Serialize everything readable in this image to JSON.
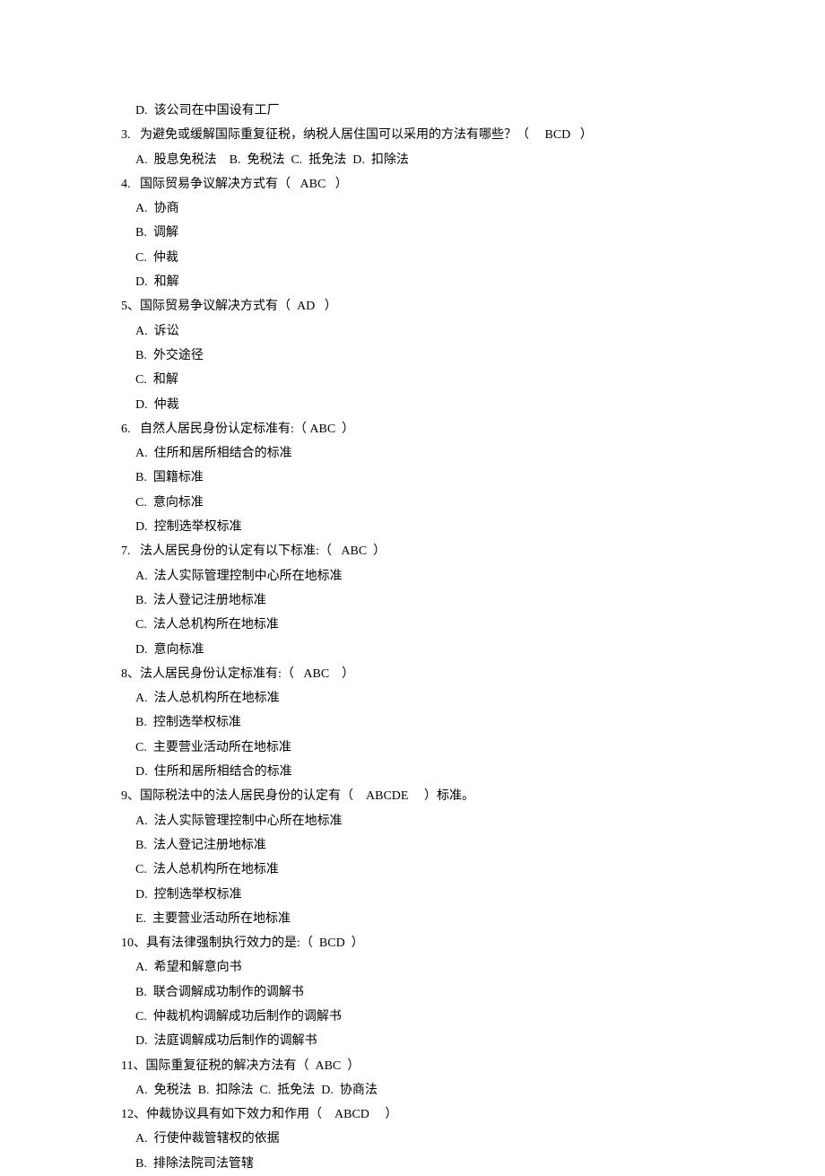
{
  "lines": [
    {
      "cls": "indent1",
      "text": "D.  该公司在中国设有工厂"
    },
    {
      "cls": "",
      "text": "3.   为避免或缓解国际重复征税，纳税人居住国可以采用的方法有哪些？（     BCD   ）"
    },
    {
      "cls": "indent1",
      "text": "A.  股息免税法    B.  免税法  C.  抵免法  D.  扣除法"
    },
    {
      "cls": "",
      "text": "4.   国际贸易争议解决方式有（   ABC   ）"
    },
    {
      "cls": "indent1",
      "text": "A.  协商"
    },
    {
      "cls": "indent1",
      "text": "B.  调解"
    },
    {
      "cls": "indent1",
      "text": "C.  仲裁"
    },
    {
      "cls": "indent1",
      "text": "D.  和解"
    },
    {
      "cls": "",
      "text": "5、国际贸易争议解决方式有（  AD   ）"
    },
    {
      "cls": "indent1",
      "text": "A.  诉讼"
    },
    {
      "cls": "indent1",
      "text": "B.  外交途径"
    },
    {
      "cls": "indent1",
      "text": "C.  和解"
    },
    {
      "cls": "indent1",
      "text": "D.  仲裁"
    },
    {
      "cls": "",
      "text": "6.   自然人居民身份认定标准有:（ ABC  ）"
    },
    {
      "cls": "indent1",
      "text": "A.  住所和居所相结合的标准"
    },
    {
      "cls": "indent1",
      "text": "B.  国籍标准"
    },
    {
      "cls": "indent1",
      "text": "C.  意向标准"
    },
    {
      "cls": "indent1",
      "text": "D.  控制选举权标准"
    },
    {
      "cls": "",
      "text": "7.   法人居民身份的认定有以下标准:（   ABC  ）"
    },
    {
      "cls": "indent1",
      "text": "A.  法人实际管理控制中心所在地标准"
    },
    {
      "cls": "indent1",
      "text": "B.  法人登记注册地标准"
    },
    {
      "cls": "indent1",
      "text": "C.  法人总机构所在地标准"
    },
    {
      "cls": "indent1",
      "text": "D.  意向标准"
    },
    {
      "cls": "",
      "text": "8、法人居民身份认定标准有:（   ABC    ）"
    },
    {
      "cls": "indent1",
      "text": "A.  法人总机构所在地标准"
    },
    {
      "cls": "indent1",
      "text": "B.  控制选举权标准"
    },
    {
      "cls": "indent1",
      "text": "C.  主要营业活动所在地标准"
    },
    {
      "cls": "indent1",
      "text": "D.  住所和居所相结合的标准"
    },
    {
      "cls": "",
      "text": "9、国际税法中的法人居民身份的认定有（    ABCDE     ）标准。"
    },
    {
      "cls": "indent1",
      "text": "A.  法人实际管理控制中心所在地标准"
    },
    {
      "cls": "indent1",
      "text": "B.  法人登记注册地标准"
    },
    {
      "cls": "indent1",
      "text": "C.  法人总机构所在地标准"
    },
    {
      "cls": "indent1",
      "text": "D.  控制选举权标准"
    },
    {
      "cls": "indent1",
      "text": "E.  主要营业活动所在地标准"
    },
    {
      "cls": "",
      "text": "10、具有法律强制执行效力的是:（  BCD  ）"
    },
    {
      "cls": "indent1",
      "text": "A.  希望和解意向书"
    },
    {
      "cls": "indent1",
      "text": "B.  联合调解成功制作的调解书"
    },
    {
      "cls": "indent1",
      "text": "C.  仲裁机构调解成功后制作的调解书"
    },
    {
      "cls": "indent1",
      "text": "D.  法庭调解成功后制作的调解书"
    },
    {
      "cls": "",
      "text": "11、国际重复征税的解决方法有（  ABC  ）"
    },
    {
      "cls": "indent1",
      "text": "A.  免税法  B.  扣除法  C.  抵免法  D.  协商法"
    },
    {
      "cls": "",
      "text": "12、仲裁协议具有如下效力和作用（    ABCD     ）"
    },
    {
      "cls": "indent1",
      "text": "A.  行使仲裁管辖权的依据"
    },
    {
      "cls": "indent1",
      "text": "B.  排除法院司法管辖"
    }
  ]
}
